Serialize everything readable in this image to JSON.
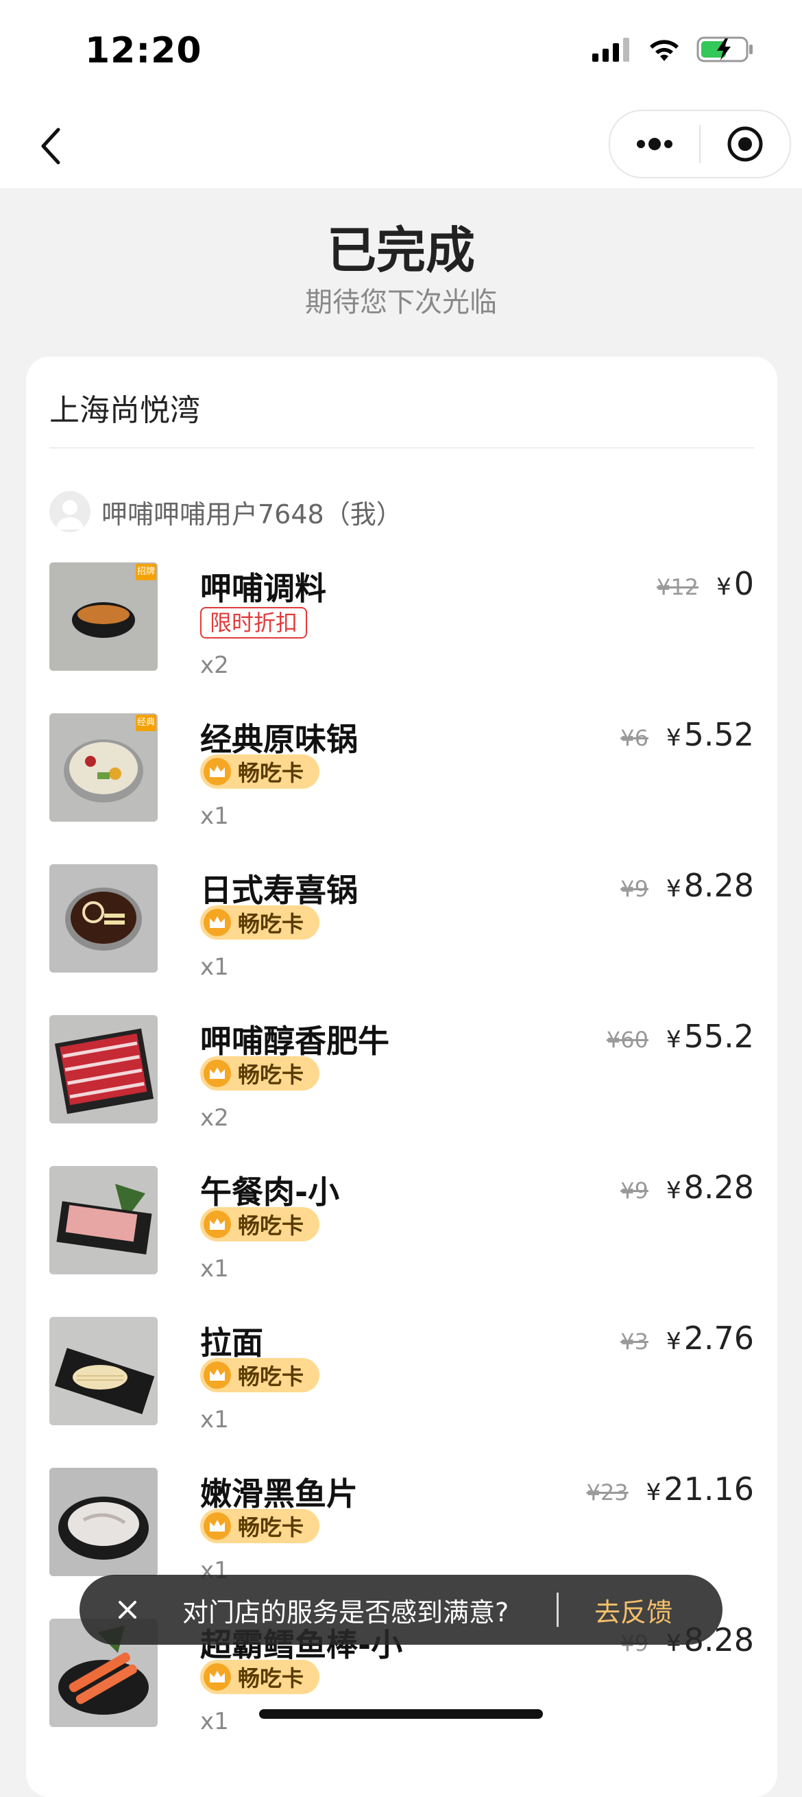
{
  "statusbar": {
    "time": "12:20"
  },
  "header": {
    "status": "已完成",
    "subtitle": "期待您下次光临"
  },
  "store": {
    "name": "上海尚悦湾"
  },
  "user": {
    "name": "呷哺呷哺用户7648（我）"
  },
  "items": [
    {
      "name": "呷哺调料",
      "badge": "限时折扣",
      "badge_type": "limited",
      "qty": "x2",
      "orig": "¥12",
      "price": "0",
      "yen": "¥",
      "tag": "招牌",
      "dish": "sauce"
    },
    {
      "name": "经典原味锅",
      "badge": "畅吃卡",
      "badge_type": "card",
      "qty": "x1",
      "orig": "¥6",
      "price": "5.52",
      "yen": "¥",
      "tag": "经典",
      "dish": "pot"
    },
    {
      "name": "日式寿喜锅",
      "badge": "畅吃卡",
      "badge_type": "card",
      "qty": "x1",
      "orig": "¥9",
      "price": "8.28",
      "yen": "¥",
      "dish": "pot2"
    },
    {
      "name": "呷哺醇香肥牛",
      "badge": "畅吃卡",
      "badge_type": "card",
      "qty": "x2",
      "orig": "¥60",
      "price": "55.2",
      "yen": "¥",
      "dish": "beef"
    },
    {
      "name": "午餐肉-小",
      "badge": "畅吃卡",
      "badge_type": "card",
      "qty": "x1",
      "orig": "¥9",
      "price": "8.28",
      "yen": "¥",
      "dish": "spam"
    },
    {
      "name": "拉面",
      "badge": "畅吃卡",
      "badge_type": "card",
      "qty": "x1",
      "orig": "¥3",
      "price": "2.76",
      "yen": "¥",
      "dish": "noodle"
    },
    {
      "name": "嫩滑黑鱼片",
      "badge": "畅吃卡",
      "badge_type": "card",
      "qty": "x1",
      "orig": "¥23",
      "price": "21.16",
      "yen": "¥",
      "dish": "fish"
    },
    {
      "name": "超霸鳕鱼棒-小",
      "badge": "畅吃卡",
      "badge_type": "card",
      "qty": "x1",
      "orig": "¥9",
      "price": "8.28",
      "yen": "¥",
      "dish": "crab"
    }
  ],
  "toast": {
    "message": "对门店的服务是否感到满意?",
    "action": "去反馈"
  },
  "colors": {
    "accent_gold": "#ffd98f",
    "limited_red": "#e23b3b",
    "feedback_gold": "#f5c06a"
  }
}
